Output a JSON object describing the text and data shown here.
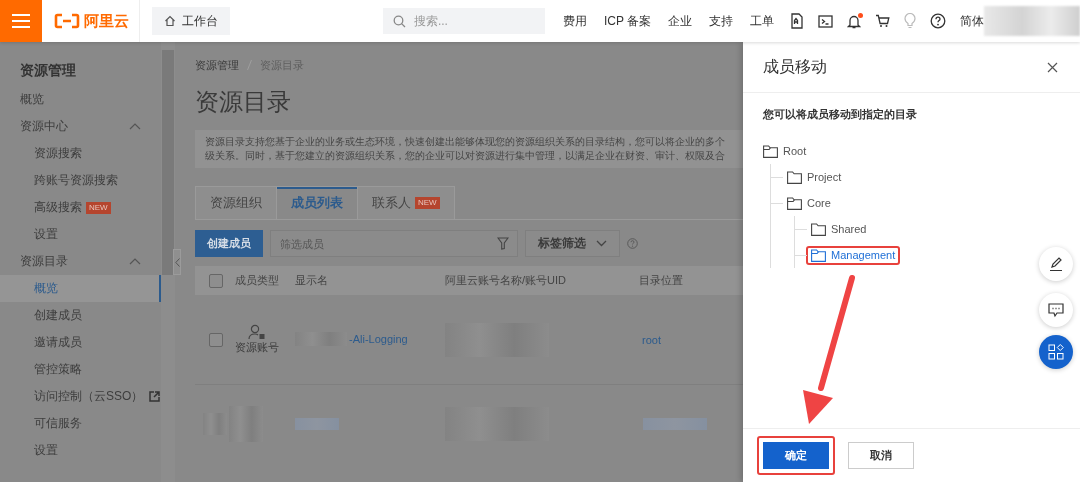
{
  "topbar": {
    "logo": "阿里云",
    "workbench": "工作台",
    "search": {
      "placeholder": "搜索..."
    },
    "nav": [
      "费用",
      "ICP 备案",
      "企业",
      "支持",
      "工单"
    ],
    "unread_notifications": true,
    "language": "简体"
  },
  "sidebar": {
    "title": "资源管理",
    "items": [
      {
        "label": "概览",
        "selected": false
      },
      {
        "label": "资源中心",
        "expanded": true,
        "children": [
          {
            "label": "资源搜索",
            "selected": false
          },
          {
            "label": "跨账号资源搜索",
            "selected": false
          },
          {
            "label": "高级搜索",
            "badge": "NEW",
            "selected": false
          },
          {
            "label": "设置",
            "selected": false
          }
        ]
      },
      {
        "label": "资源目录",
        "expanded": true,
        "children": [
          {
            "label": "概览",
            "selected": true
          },
          {
            "label": "创建成员",
            "selected": false
          },
          {
            "label": "邀请成员",
            "selected": false
          },
          {
            "label": "管控策略",
            "selected": false
          },
          {
            "label": "访问控制（云SSO）",
            "external": true,
            "selected": false
          },
          {
            "label": "可信服务",
            "selected": false
          },
          {
            "label": "设置",
            "selected": false
          }
        ]
      }
    ]
  },
  "breadcrumb": [
    "资源管理",
    "资源目录"
  ],
  "page_title": "资源目录",
  "description_lines": [
    "资源目录支持您基于企业的业务或生态环境，快速创建出能够体现您的资源组织关系的目录结构，您可以将企业的多个",
    "级关系。同时，基于您建立的资源组织关系，您的企业可以对资源进行集中管理，以满足企业在财资、审计、权限及合"
  ],
  "tabs": [
    {
      "label": "资源组织",
      "selected": false
    },
    {
      "label": "成员列表",
      "selected": true
    },
    {
      "label": "联系人",
      "badge": "NEW",
      "selected": false
    }
  ],
  "create_button": "创建成员",
  "member_filter": {
    "placeholder": "筛选成员"
  },
  "tag_filter": "标签筛选",
  "table": {
    "all_checked": false,
    "columns": [
      "成员类型",
      "显示名",
      "阿里云账号名称/账号UID",
      "目录位置"
    ],
    "rows": [
      {
        "kind": "member",
        "checked": false,
        "member_type": "资源账号",
        "display_name": "-Ali-Logging",
        "location": "root"
      },
      {
        "kind": "redacted"
      }
    ]
  },
  "drawer": {
    "title": "成员移动",
    "subtitle": "您可以将成员移动到指定的目录",
    "tree": [
      {
        "label": "Root",
        "expanded": true,
        "selected": false,
        "highlighted": false,
        "children": [
          {
            "label": "Project",
            "selected": false,
            "highlighted": false
          },
          {
            "label": "Core",
            "expanded": true,
            "selected": false,
            "highlighted": false,
            "children": [
              {
                "label": "Shared",
                "selected": false,
                "highlighted": false
              },
              {
                "label": "Management",
                "selected": true,
                "highlighted": true
              }
            ]
          }
        ]
      }
    ],
    "buttons": [
      {
        "label": "确定",
        "kind": "primary",
        "highlighted": true
      },
      {
        "label": "取消",
        "kind": "secondary",
        "highlighted": false
      }
    ]
  }
}
